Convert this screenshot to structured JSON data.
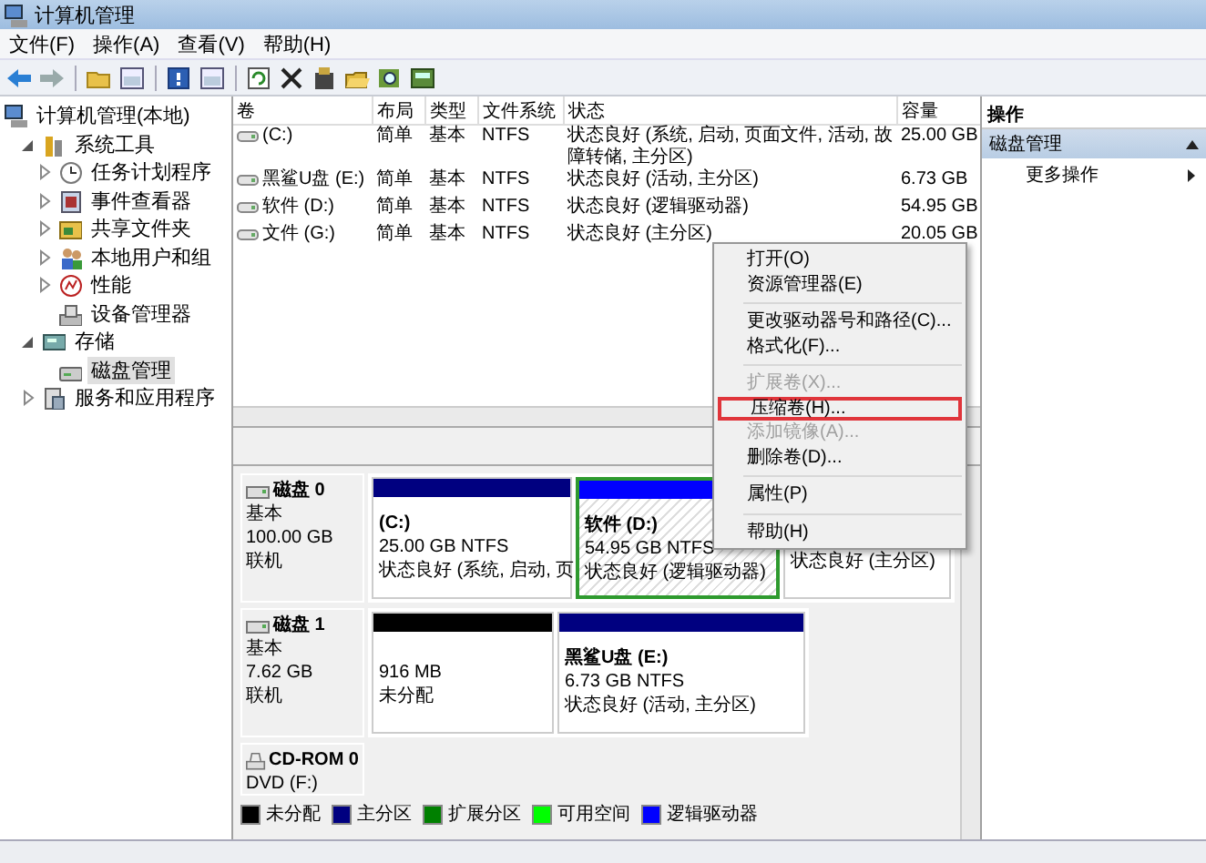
{
  "window": {
    "title": "计算机管理"
  },
  "menu_bar": [
    "文件(F)",
    "操作(A)",
    "查看(V)",
    "帮助(H)"
  ],
  "tree": [
    {
      "label": "计算机管理(本地)",
      "selected": false,
      "children": [
        {
          "label": "系统工具",
          "selected": false,
          "expanded": true,
          "children": [
            {
              "label": "任务计划程序",
              "selected": false,
              "expanded": false
            },
            {
              "label": "事件查看器",
              "selected": false,
              "expanded": false
            },
            {
              "label": "共享文件夹",
              "selected": false,
              "expanded": false
            },
            {
              "label": "本地用户和组",
              "selected": false,
              "expanded": false
            },
            {
              "label": "性能",
              "selected": false,
              "expanded": false
            },
            {
              "label": "设备管理器",
              "selected": false
            }
          ]
        },
        {
          "label": "存储",
          "selected": false,
          "expanded": true,
          "children": [
            {
              "label": "磁盘管理",
              "selected": true
            }
          ]
        },
        {
          "label": "服务和应用程序",
          "selected": false,
          "expanded": false
        }
      ]
    }
  ],
  "volume_table": {
    "columns": [
      "卷",
      "布局",
      "类型",
      "文件系统",
      "状态",
      "容量"
    ],
    "rows": [
      [
        "(C:)",
        "简单",
        "基本",
        "NTFS",
        "状态良好 (系统, 启动, 页面文件, 活动, 故障转储, 主分区)",
        "25.00 GB"
      ],
      [
        "黑鲨U盘 (E:)",
        "简单",
        "基本",
        "NTFS",
        "状态良好 (活动, 主分区)",
        "6.73 GB"
      ],
      [
        "软件 (D:)",
        "简单",
        "基本",
        "NTFS",
        "状态良好 (逻辑驱动器)",
        "54.95 GB"
      ],
      [
        "文件 (G:)",
        "简单",
        "基本",
        "NTFS",
        "状态良好 (主分区)",
        "20.05 GB"
      ]
    ]
  },
  "disks": [
    {
      "name": "磁盘 0",
      "type": "基本",
      "size": "100.00 GB",
      "status": "联机",
      "partitions": [
        {
          "kind": "primary",
          "label": "(C:)",
          "size": "25.00 GB NTFS",
          "status": "状态良好 (系统, 启动, 页",
          "selected": false
        },
        {
          "kind": "logical",
          "label": "软件  (D:)",
          "size": "54.95 GB NTFS",
          "status": "状态良好 (逻辑驱动器)",
          "selected": true
        },
        {
          "status": "状态良好 (主分区)",
          "selected": false
        }
      ]
    },
    {
      "name": "磁盘 1",
      "type": "基本",
      "size": "7.62 GB",
      "status": "联机",
      "partitions": [
        {
          "kind": "unallocated",
          "size": "916 MB",
          "status": "未分配",
          "selected": false
        },
        {
          "kind": "primary",
          "label": "黑鲨U盘  (E:)",
          "size": "6.73 GB NTFS",
          "status": "状态良好 (活动, 主分区)",
          "selected": false
        }
      ]
    }
  ],
  "cdrom": {
    "name": "CD-ROM 0",
    "type": "DVD (F:)"
  },
  "legend": [
    {
      "label": "未分配",
      "color": "#000000"
    },
    {
      "label": "主分区",
      "color": "#000080"
    },
    {
      "label": "扩展分区",
      "color": "#008000"
    },
    {
      "label": "可用空间",
      "color": "#00ff00"
    },
    {
      "label": "逻辑驱动器",
      "color": "#0000ff"
    }
  ],
  "actions": {
    "title": "操作",
    "section": {
      "label": "磁盘管理",
      "expanded": true
    },
    "items": [
      "更多操作"
    ]
  },
  "context_menu": [
    {
      "kind": "item",
      "label": "打开(O)",
      "disabled": false,
      "highlighted": false
    },
    {
      "kind": "item",
      "label": "资源管理器(E)",
      "disabled": false,
      "highlighted": false
    },
    {
      "kind": "separator"
    },
    {
      "kind": "item",
      "label": "更改驱动器号和路径(C)...",
      "disabled": false,
      "highlighted": false
    },
    {
      "kind": "item",
      "label": "格式化(F)...",
      "disabled": false,
      "highlighted": false
    },
    {
      "kind": "separator"
    },
    {
      "kind": "item",
      "label": "扩展卷(X)...",
      "disabled": true,
      "highlighted": false
    },
    {
      "kind": "item",
      "label": "压缩卷(H)...",
      "disabled": false,
      "highlighted": true
    },
    {
      "kind": "item",
      "label": "添加镜像(A)...",
      "disabled": true,
      "highlighted": false
    },
    {
      "kind": "item",
      "label": "删除卷(D)...",
      "disabled": false,
      "highlighted": false
    },
    {
      "kind": "separator"
    },
    {
      "kind": "item",
      "label": "属性(P)",
      "disabled": false,
      "highlighted": false
    },
    {
      "kind": "separator"
    },
    {
      "kind": "item",
      "label": "帮助(H)",
      "disabled": false,
      "highlighted": false
    }
  ]
}
